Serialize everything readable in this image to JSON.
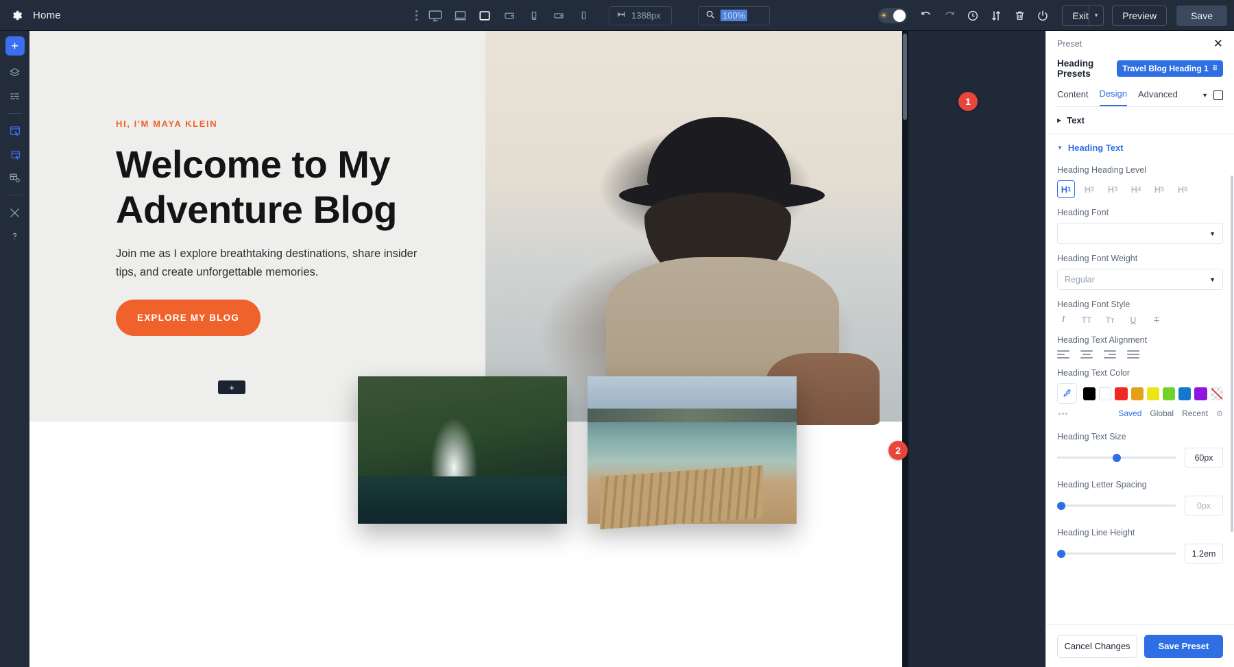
{
  "topbar": {
    "gear_icon": "gear-icon",
    "home_label": "Home",
    "devices": [
      {
        "name": "desktop",
        "icon": "monitor-icon",
        "active": false
      },
      {
        "name": "laptop",
        "icon": "laptop-icon",
        "active": false
      },
      {
        "name": "tablet-landscape",
        "icon": "tablet-landscape-icon",
        "active": true
      },
      {
        "name": "tablet",
        "icon": "tablet-icon",
        "active": false
      },
      {
        "name": "mobile-landscape",
        "icon": "mobile-landscape-icon",
        "active": false
      },
      {
        "name": "mobile-wide",
        "icon": "mobile-wide-icon",
        "active": false
      },
      {
        "name": "mobile",
        "icon": "mobile-icon",
        "active": false
      }
    ],
    "width_value": "1388px",
    "zoom_value": "100%",
    "theme_toggle_icon": "sun-icon",
    "icons": [
      "undo-icon",
      "redo-icon",
      "history-icon",
      "sort-icon",
      "trash-icon",
      "power-icon"
    ],
    "exit_label": "Exit",
    "preview_label": "Preview",
    "save_label": "Save"
  },
  "rail": {
    "add_label": "+",
    "items": [
      "layers-icon",
      "list-icon",
      "widget-icon",
      "section-icon",
      "template-icon",
      "tools-icon",
      "help-icon"
    ]
  },
  "canvas": {
    "eyebrow": "HI, I'M MAYA KLEIN",
    "heading": "Welcome to My Adventure Blog",
    "subtext": "Join me as I explore breathtaking destinations, share insider tips, and create unforgettable memories.",
    "cta_label": "EXPLORE MY BLOG",
    "add_chip_label": "+"
  },
  "panel": {
    "preset_label": "Preset",
    "close_icon": "close-icon",
    "heading_presets_label": "Heading Presets",
    "preset_chip": "Travel Blog Heading 1",
    "tabs": [
      {
        "label": "Content",
        "active": false
      },
      {
        "label": "Design",
        "active": true
      },
      {
        "label": "Advanced",
        "active": false
      }
    ],
    "section_text": "Text",
    "section_heading_text": "Heading Text",
    "heading_level": {
      "label": "Heading Heading Level",
      "options": [
        "H1",
        "H2",
        "H3",
        "H4",
        "H5",
        "H6"
      ],
      "selected": "H1"
    },
    "heading_font": {
      "label": "Heading Font",
      "value": ""
    },
    "heading_font_weight": {
      "label": "Heading Font Weight",
      "value": "Regular"
    },
    "heading_font_style": {
      "label": "Heading Font Style",
      "options": [
        "italic-icon",
        "uppercase-icon",
        "capitalize-icon",
        "underline-icon",
        "strikethrough-icon"
      ],
      "glyphs": [
        "I",
        "TT",
        "Tт",
        "U",
        "T"
      ]
    },
    "heading_text_alignment": {
      "label": "Heading Text Alignment",
      "options": [
        "align-left-icon",
        "align-center-icon",
        "align-right-icon",
        "align-justify-icon"
      ]
    },
    "heading_text_color": {
      "label": "Heading Text Color",
      "eyedropper_icon": "eyedropper-icon",
      "swatches": [
        "#000000",
        "#ffffff",
        "#ee2a24",
        "#e5a019",
        "#ece618",
        "#6fd32b",
        "#1479cc",
        "#8f16e0",
        "transparent"
      ],
      "tabs": [
        "Saved",
        "Global",
        "Recent"
      ],
      "active_tab": "Saved",
      "gear_icon": "gear-icon"
    },
    "heading_text_size": {
      "label": "Heading Text Size",
      "value": "60px",
      "slider_pct": 50
    },
    "heading_letter_spacing": {
      "label": "Heading Letter Spacing",
      "value": "0px",
      "slider_pct": 0
    },
    "heading_line_height": {
      "label": "Heading Line Height",
      "value": "1.2em",
      "slider_pct": 1
    },
    "cancel_label": "Cancel Changes",
    "save_preset_label": "Save Preset"
  },
  "badges": {
    "one": "1",
    "two": "2"
  }
}
